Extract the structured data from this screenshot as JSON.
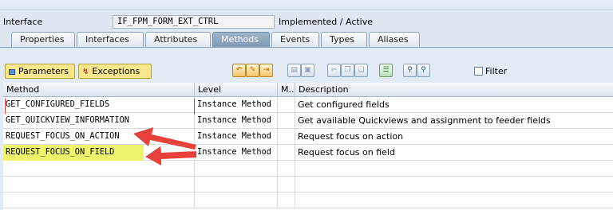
{
  "interface": {
    "label": "Interface",
    "name": "IF_FPM_FORM_EXT_CTRL",
    "status": "Implemented / Active"
  },
  "tabs": [
    {
      "label": "Properties"
    },
    {
      "label": "Interfaces"
    },
    {
      "label": "Attributes"
    },
    {
      "label": "Methods",
      "active": true
    },
    {
      "label": "Events"
    },
    {
      "label": "Types"
    },
    {
      "label": "Aliases"
    }
  ],
  "toolbar": {
    "parameters_label": "Parameters",
    "exceptions_label": "Exceptions",
    "filter_label": "Filter",
    "filter_checked": false,
    "icons": [
      "undo-icon",
      "edit-icon",
      "insert-icon",
      "append-row-icon",
      "delete-row-icon",
      "cut-icon",
      "copy-icon",
      "paste-icon",
      "detail-icon",
      "find-icon",
      "find-next-icon"
    ]
  },
  "table": {
    "columns": [
      "Method",
      "Level",
      "M...",
      "Description"
    ],
    "rows": [
      {
        "method": "GET_CONFIGURED_FIELDS",
        "level": "Instance Method",
        "m": "",
        "description": "Get configured fields"
      },
      {
        "method": "GET_QUICKVIEW_INFORMATION",
        "level": "Instance Method",
        "m": "",
        "description": "Get available Quickviews and assignment to feeder fields"
      },
      {
        "method": "REQUEST_FOCUS_ON_ACTION",
        "level": "Instance Method",
        "m": "",
        "description": "Request focus on action"
      },
      {
        "method": "REQUEST_FOCUS_ON_FIELD",
        "level": "Instance Method",
        "m": "",
        "description": "Request focus on field",
        "highlighted": true
      }
    ]
  },
  "colors": {
    "arrow": "#e8413c",
    "highlight": "#eef56b",
    "active_tab": "#8aa3bf",
    "toggle_button": "#f9e88b"
  }
}
